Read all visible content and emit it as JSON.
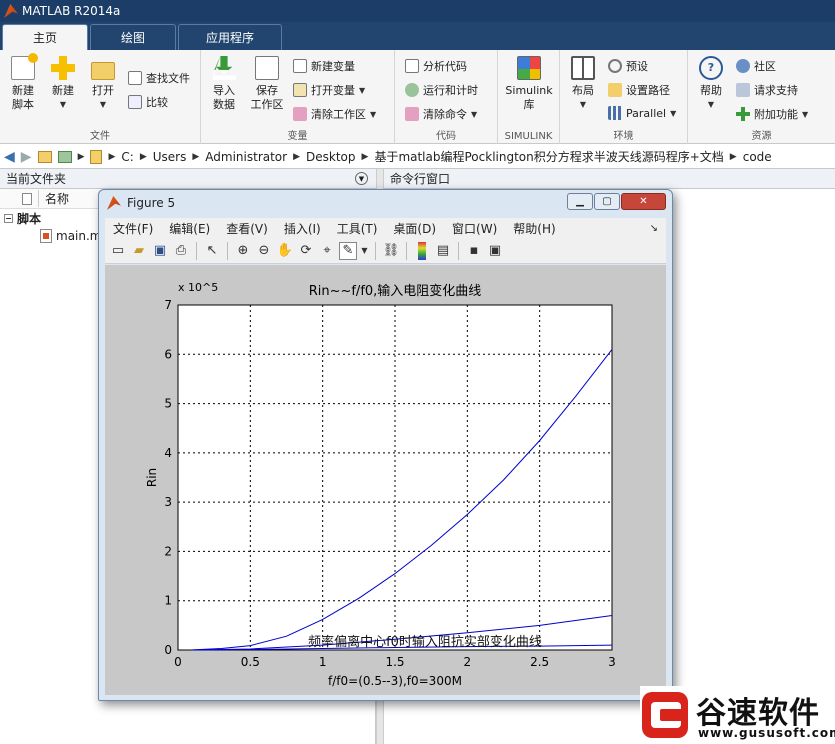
{
  "app": {
    "title": "MATLAB R2014a"
  },
  "tabs": [
    {
      "label": "主页"
    },
    {
      "label": "绘图"
    },
    {
      "label": "应用程序"
    }
  ],
  "ribbon": {
    "file": {
      "section": "文件",
      "new_script": "新建\n脚本",
      "new": "新建",
      "open": "打开",
      "find_files": "查找文件",
      "compare": "比较"
    },
    "variable": {
      "section": "变量",
      "import": "导入\n数据",
      "save_ws": "保存\n工作区",
      "new_var": "新建变量",
      "open_var": "打开变量",
      "clear_ws": "清除工作区"
    },
    "code": {
      "section": "代码",
      "analyze": "分析代码",
      "run_time": "运行和计时",
      "clear_cmd": "清除命令"
    },
    "simulink": {
      "section": "SIMULINK",
      "lib": "Simulink\n库"
    },
    "env": {
      "section": "环境",
      "layout": "布局",
      "prefs": "预设",
      "set_path": "设置路径",
      "parallel": "Parallel"
    },
    "resources": {
      "section": "资源",
      "help": "帮助",
      "community": "社区",
      "support": "请求支持",
      "addons": "附加功能"
    }
  },
  "address": {
    "parts": [
      "C:",
      "Users",
      "Administrator",
      "Desktop",
      "基于matlab编程Pocklington积分方程求半波天线源码程序+文档",
      "code"
    ]
  },
  "file_panel": {
    "title": "当前文件夹",
    "col_name": "名称",
    "group": "脚本",
    "file": "main.m"
  },
  "cmd_panel": {
    "title": "命令行窗口"
  },
  "figure": {
    "title": "Figure 5",
    "menus": [
      "文件(F)",
      "编辑(E)",
      "查看(V)",
      "插入(I)",
      "工具(T)",
      "桌面(D)",
      "窗口(W)",
      "帮助(H)"
    ]
  },
  "chart_data": {
    "type": "line",
    "title": "Rin~~f/f0,输入电阻变化曲线",
    "xlabel": "f/f0=(0.5--3),f0=300M",
    "ylabel": "Rin",
    "y_exponent": "x 10^5",
    "xlim": [
      0,
      3
    ],
    "ylim": [
      0,
      7
    ],
    "x_ticks": [
      "0",
      "0.5",
      "1",
      "1.5",
      "2",
      "2.5",
      "3"
    ],
    "y_ticks": [
      "0",
      "1",
      "2",
      "3",
      "4",
      "5",
      "6",
      "7"
    ],
    "grid": true,
    "overlay_text": "频率偏离中心f0时输入阻抗实部变化曲线",
    "series": [
      {
        "x": [
          0.1,
          0.3,
          0.5,
          0.75,
          1.0,
          1.25,
          1.5,
          1.75,
          2.0,
          2.25,
          2.5,
          2.75,
          3.0
        ],
        "values": [
          0.003,
          0.03,
          0.09,
          0.28,
          0.62,
          1.05,
          1.55,
          2.12,
          2.75,
          3.45,
          4.25,
          5.15,
          6.1
        ]
      },
      {
        "x": [
          0.1,
          0.5,
          1.0,
          1.5,
          2.0,
          2.5,
          3.0
        ],
        "values": [
          0.0,
          0.02,
          0.1,
          0.22,
          0.35,
          0.5,
          0.7
        ]
      },
      {
        "x": [
          0.1,
          0.5,
          1.0,
          1.5,
          2.0,
          2.5,
          3.0
        ],
        "values": [
          0.0,
          0.01,
          0.03,
          0.05,
          0.07,
          0.08,
          0.1
        ]
      }
    ],
    "line_color": "#0000cc"
  },
  "watermark": {
    "brand": "谷速软件",
    "url": "www.gususoft.com"
  }
}
